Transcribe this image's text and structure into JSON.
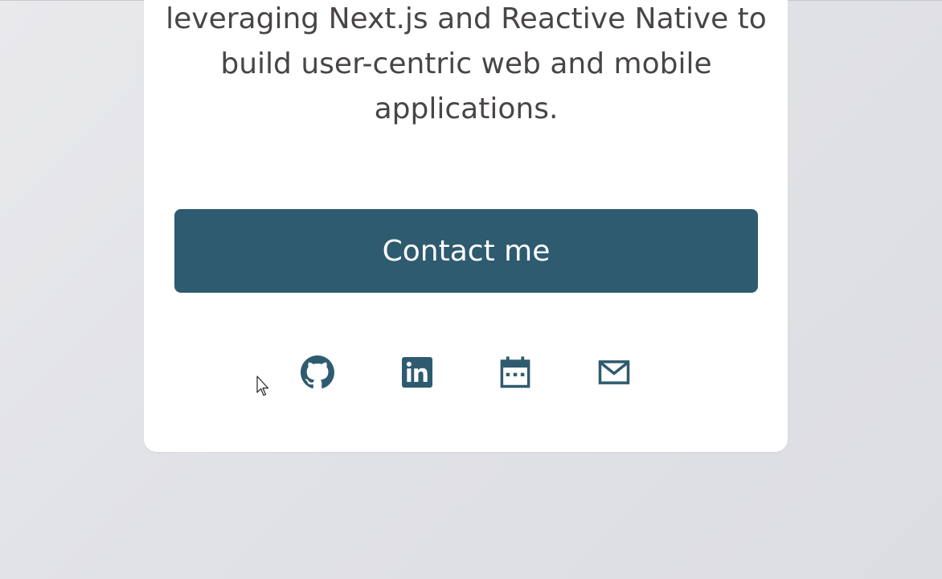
{
  "intro": {
    "text": "leveraging Next.js and Reactive Native to build user-centric web and mobile applications."
  },
  "contact_button": {
    "label": "Contact me"
  },
  "social_links": [
    {
      "name": "github",
      "icon": "github-icon"
    },
    {
      "name": "linkedin",
      "icon": "linkedin-icon"
    },
    {
      "name": "calendar",
      "icon": "calendar-icon"
    },
    {
      "name": "email",
      "icon": "mail-icon"
    }
  ],
  "colors": {
    "accent": "#2e5b6f",
    "text": "#4a4545",
    "card": "#ffffff",
    "background": "#e2e3e7"
  }
}
